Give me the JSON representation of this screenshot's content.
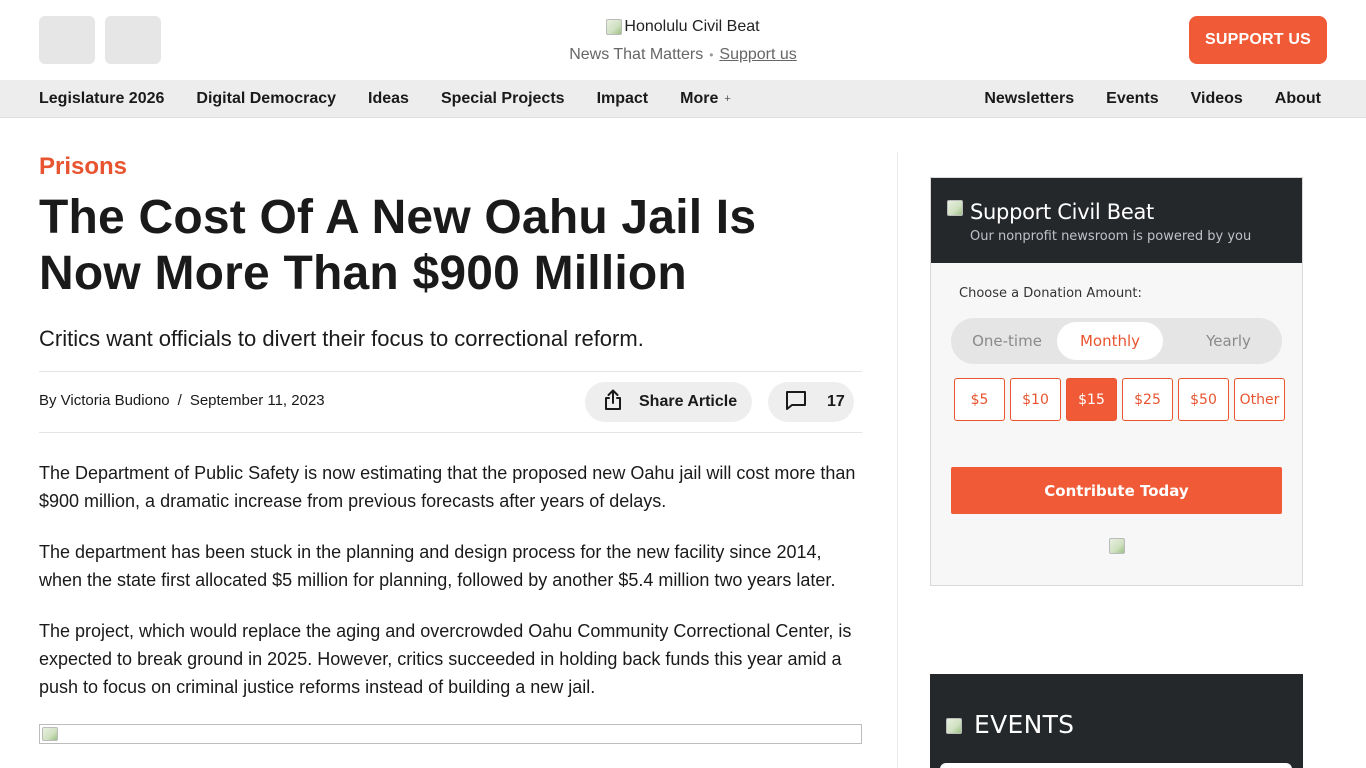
{
  "header": {
    "icon_button_1": "",
    "icon_button_2": "",
    "logo_alt": "Honolulu Civil Beat",
    "tagline": "News That Matters",
    "tagline_separator": "•",
    "tagline_link": "Support us",
    "support_button": "SUPPORT US"
  },
  "nav": {
    "left": [
      {
        "label": "Legislature 2026"
      },
      {
        "label": "Digital Democracy"
      },
      {
        "label": "Ideas"
      },
      {
        "label": "Special Projects"
      },
      {
        "label": "Impact"
      },
      {
        "label": "More",
        "glyph": "+"
      }
    ],
    "right": [
      {
        "label": "Newsletters"
      },
      {
        "label": "Events"
      },
      {
        "label": "Videos"
      },
      {
        "label": "About",
        "glyph": ""
      }
    ]
  },
  "article": {
    "kicker": "Prisons",
    "headline": "The Cost Of A New Oahu Jail Is Now More Than $900 Million",
    "dek": "Critics want officials to divert their focus to correctional reform.",
    "byline": "By Victoria Budiono",
    "byline_separator": "/",
    "date": "September 11, 2023",
    "share_label": "Share Article",
    "comment_count": "17",
    "paragraphs": [
      "The Department of Public Safety is now estimating that the proposed new Oahu jail will cost more than $900 million, a dramatic increase from previous forecasts after years of delays.",
      "The department has been stuck in the planning and design process for the new facility since 2014, when the state first allocated $5 million for planning, followed by another $5.4 million two years later.",
      "The project, which would replace the aging and overcrowded Oahu Community Correctional Center, is expected to break ground in 2025. However, critics succeeded in holding back funds this year amid a push to focus on criminal justice reforms instead of building a new jail."
    ]
  },
  "donate": {
    "title": "Support Civil Beat",
    "subtitle": "Our nonprofit newsroom is powered by you",
    "amount_label": "Choose a Donation Amount:",
    "frequencies": [
      "One-time",
      "Monthly",
      "Yearly"
    ],
    "selected_frequency": "Monthly",
    "amounts": [
      "$5",
      "$10",
      "$15",
      "$25",
      "$50",
      "Other"
    ],
    "selected_amount": "$15",
    "contribute_label": "Contribute Today"
  },
  "events": {
    "title": "EVENTS"
  },
  "colors": {
    "accent": "#f15a37",
    "kicker": "#e8542f",
    "dark_panel": "#25282b",
    "nav_bg": "#ededed"
  }
}
